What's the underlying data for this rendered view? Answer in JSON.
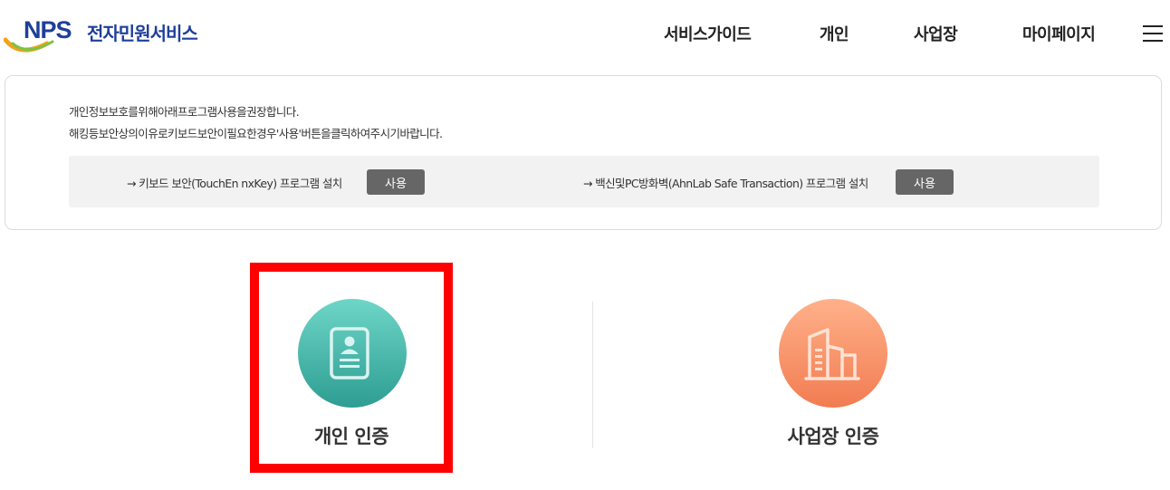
{
  "header": {
    "logo_mark": "NPS",
    "logo_text": "전자민원서비스",
    "nav": {
      "guide": "서비스가이드",
      "personal": "개인",
      "business": "사업장",
      "mypage": "마이페이지"
    }
  },
  "notice": {
    "line1": "개인정보보호를위해아래프로그램사용을권장합니다.",
    "line2": "해킹등보안상의이유로키보드보안이필요한경우'사용'버튼을클릭하여주시기바랍니다.",
    "install": [
      {
        "label": "→ 키보드 보안(TouchEn nxKey) 프로그램 설치",
        "button": "사용"
      },
      {
        "label": "→ 백신및PC방화벽(AhnLab Safe Transaction) 프로그램 설치",
        "button": "사용"
      }
    ]
  },
  "auth": {
    "personal_label": "개인 인증",
    "business_label": "사업장 인증"
  },
  "colors": {
    "brand_blue": "#1f3f99",
    "highlight": "#ff0000",
    "personal_circle": "#3fb3a6",
    "business_circle": "#f79468",
    "button_gray": "#666666"
  },
  "icons": {
    "personal": "id-card-icon",
    "business": "building-icon",
    "menu": "hamburger-menu-icon"
  }
}
